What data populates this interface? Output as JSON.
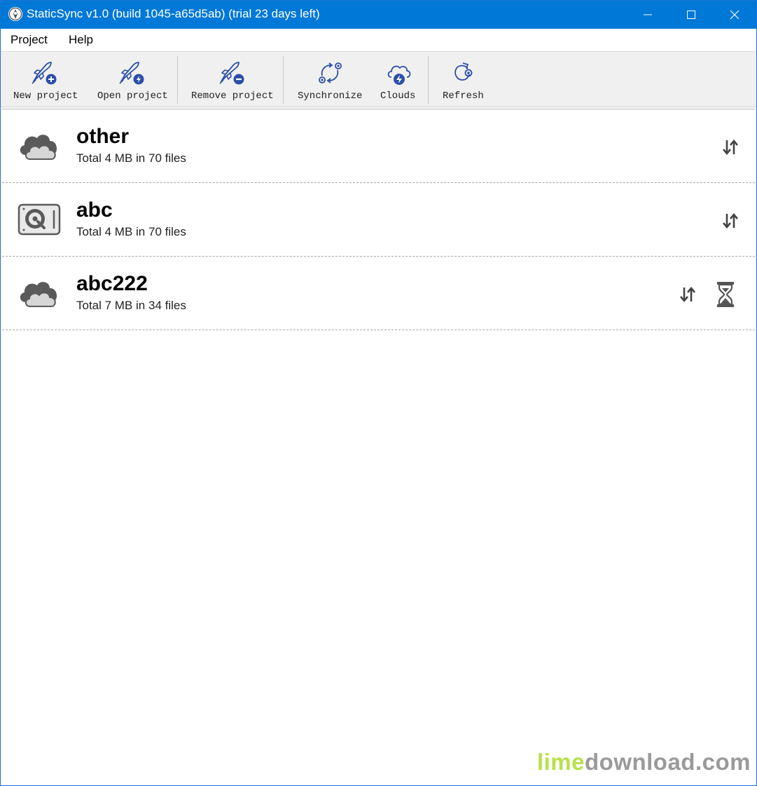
{
  "window": {
    "title": "StaticSync v1.0 (build 1045-a65d5ab) (trial 23 days left)"
  },
  "menu": {
    "project": "Project",
    "help": "Help"
  },
  "toolbar": {
    "new_project": "New project",
    "open_project": "Open project",
    "remove_project": "Remove project",
    "synchronize": "Synchronize",
    "clouds": "Clouds",
    "refresh": "Refresh"
  },
  "projects": [
    {
      "name": "other",
      "info": "Total 4 MB in 70 files",
      "icon": "cloud-icon",
      "status": ""
    },
    {
      "name": "abc",
      "info": "Total 4 MB in 70 files",
      "icon": "hard-drive-icon",
      "status": ""
    },
    {
      "name": "abc222",
      "info": "Total 7 MB in 34 files",
      "icon": "cloud-icon",
      "status": "hourglass-icon"
    }
  ],
  "watermark": {
    "part1": "lime",
    "part2": "download.com"
  },
  "colors": {
    "titlebar": "#0078d7",
    "icon_blue": "#2b4fa8",
    "icon_gray": "#555555"
  }
}
